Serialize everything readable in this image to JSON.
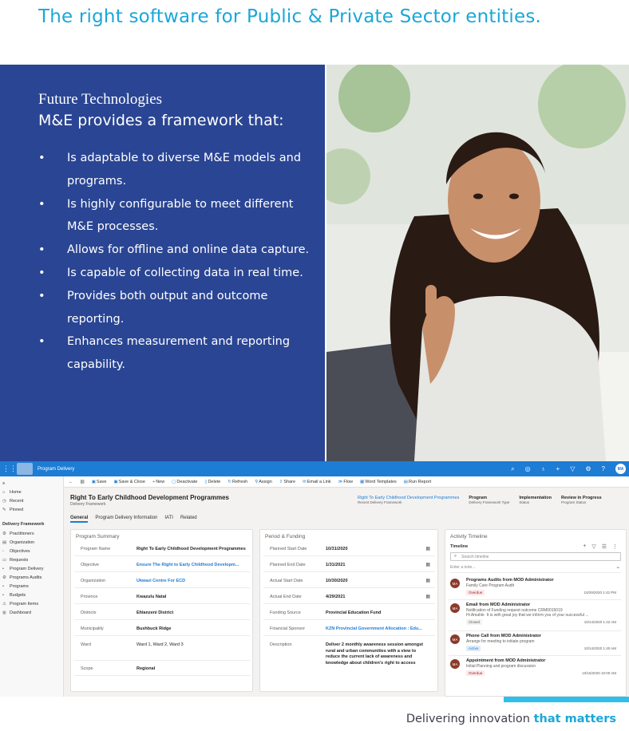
{
  "headline": "The right software for Public & Private Sector entities.",
  "panel": {
    "company": "Future Technologies",
    "lead": "M&E provides a framework that:",
    "bullet": "•",
    "features": [
      "Is adaptable to diverse M&E models and programs.",
      "Is highly configurable to meet different M&E processes.",
      "Allows for offline and online data capture.",
      "Is capable of collecting data in real time.",
      "Provides both output and outcome reporting.",
      "Enhances measurement and reporting capability."
    ]
  },
  "crm": {
    "app_name": "Program Delivery",
    "user_initials": "MA",
    "nav": {
      "items": [
        "Home",
        "Recent",
        "Pinned"
      ],
      "group": "Delivery Framework",
      "entities": [
        "Practitioners",
        "Organization",
        "Objectives",
        "Requests",
        "Program Delivery",
        "Programs Audits",
        "Programs",
        "Budgets",
        "Program Items",
        "Dashboard"
      ]
    },
    "commands": [
      "Save",
      "Save & Close",
      "New",
      "Deactivate",
      "Delete",
      "Refresh",
      "Assign",
      "Share",
      "Email a Link",
      "Flow",
      "Word Templates",
      "Run Report"
    ],
    "record": {
      "title": "Right To Early Childhood Development Programmes",
      "subtitle": "Delivery Framework",
      "header_fields": [
        {
          "value": "Right To Early Childhood Development Programmes",
          "label": "Recent Delivery Framework"
        },
        {
          "value": "Program",
          "label": "Delivery Framework Type"
        },
        {
          "value": "Implementation",
          "label": "Status"
        },
        {
          "value": "Review in Progress",
          "label": "Program Status"
        }
      ],
      "tabs": [
        "General",
        "Program Delivery Information",
        "IATI",
        "Related"
      ]
    },
    "summary": {
      "title": "Program Summary",
      "fields": [
        {
          "label": "Program Name",
          "value": "Right To Early Childhood Development Programmes"
        },
        {
          "label": "Objective",
          "value": "Ensure The Right to Early Childhood Developm..."
        },
        {
          "label": "Organization",
          "value": "Ukwazi Centre For ECD"
        },
        {
          "label": "Province",
          "value": "Kwazulu Natal"
        },
        {
          "label": "Districts",
          "value": "Ehlanzeni District"
        },
        {
          "label": "Municipality",
          "value": "Bushbuck Ridge"
        },
        {
          "label": "Ward",
          "value": "Ward 1, Ward 2, Ward 3"
        },
        {
          "label": "Scope",
          "value": "Regional"
        }
      ]
    },
    "funding": {
      "title": "Period & Funding",
      "fields": [
        {
          "label": "Planned Start Date",
          "value": "10/31/2020"
        },
        {
          "label": "Planned End Date",
          "value": "1/31/2021"
        },
        {
          "label": "Actual Start Date",
          "value": "10/30/2020"
        },
        {
          "label": "Actual End Date",
          "value": "4/29/2021"
        },
        {
          "label": "Funding Source",
          "value": "Provincial Education Fund"
        },
        {
          "label": "Financial Sponsor",
          "value": "KZN Provincial Government Allocation : Edu..."
        },
        {
          "label": "Description",
          "value": "Deliver 2 monthly awareness session amongst rural and urban communities with a view to reduce the current lack of awareness and knowledge about children's right to access"
        }
      ]
    },
    "timeline": {
      "title": "Activity Timeline",
      "subtitle": "Timeline",
      "search_placeholder": "Search timeline",
      "note_placeholder": "Enter a note...",
      "items": [
        {
          "title": "Programs Audits from MOD Administrator",
          "desc": "Family Care Program Audit",
          "badge": "Overdue",
          "date": "10/29/2020 1:42 PM"
        },
        {
          "title": "Email from MOD Administrator",
          "desc": "Notification of Funding request outcome CRM0015019\nHi Amahle  It is with great joy that we inform you of your successful ...",
          "badge": "Closed",
          "date": "10/14/2020 1:42 AM"
        },
        {
          "title": "Phone Call from MOD Administrator",
          "desc": "Arrange for meeting to initiate program",
          "badge": "Active",
          "date": "10/14/2020 1:40 AM"
        },
        {
          "title": "Appointment from MOD Administrator",
          "desc": "Initial Planning and program discussion",
          "badge": "Overdue",
          "date": "10/16/2020 10:00 AM"
        }
      ]
    }
  },
  "tagline": {
    "plain": "Delivering innovation ",
    "emphasis": "that matters"
  },
  "colors": {
    "headline": "#1aa7d9",
    "panel": "#2a4593",
    "crm_bar": "#1d7cd4",
    "accent_bar": "#2ec0e8"
  }
}
